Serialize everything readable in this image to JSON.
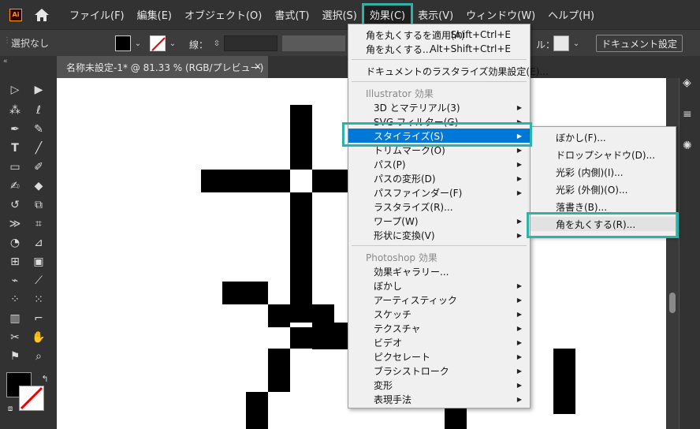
{
  "menubar": {
    "logo": "Ai",
    "items": [
      "ファイル(F)",
      "編集(E)",
      "オブジェクト(O)",
      "書式(T)",
      "選択(S)",
      "効果(C)",
      "表示(V)",
      "ウィンドウ(W)",
      "ヘルプ(H)"
    ],
    "highlighted": "効果(C)"
  },
  "controlbar": {
    "selection": "選択なし",
    "stroke_label": "線：",
    "opacity_label": "ル：",
    "doc_settings": "ドキュメント設定"
  },
  "tab": {
    "title": "名称未設定-1* @ 81.33 % (RGB/プレビュー)",
    "close": "×"
  },
  "effect_menu": {
    "apply_last": {
      "label": "角を丸くするを適用(A)",
      "shortcut": "Shift+Ctrl+E"
    },
    "last": {
      "label": "角を丸くする...",
      "shortcut": "Alt+Shift+Ctrl+E"
    },
    "raster_settings": "ドキュメントのラスタライズ効果設定(E)...",
    "illustrator_header": "Illustrator 効果",
    "illustrator_items": [
      "3D とマテリアル(3)",
      "SVG フィルター(G)",
      "スタイライズ(S)",
      "トリムマーク(O)",
      "パス(P)",
      "パスの変形(D)",
      "パスファインダー(F)",
      "ラスタライズ(R)...",
      "ワープ(W)",
      "形状に変換(V)"
    ],
    "photoshop_header": "Photoshop 効果",
    "photoshop_items": [
      "効果ギャラリー...",
      "ぼかし",
      "アーティスティック",
      "スケッチ",
      "テクスチャ",
      "ビデオ",
      "ピクセレート",
      "ブラシストローク",
      "変形",
      "表現手法"
    ]
  },
  "stylize_submenu": {
    "items": [
      "ぼかし(F)...",
      "ドロップシャドウ(D)...",
      "光彩 (内側)(I)...",
      "光彩 (外側)(O)...",
      "落書き(B)...",
      "角を丸くする(R)..."
    ]
  },
  "colors": {
    "highlight": "#2ab3a6",
    "selection": "#0078d7",
    "menubar_bg": "#323232"
  }
}
